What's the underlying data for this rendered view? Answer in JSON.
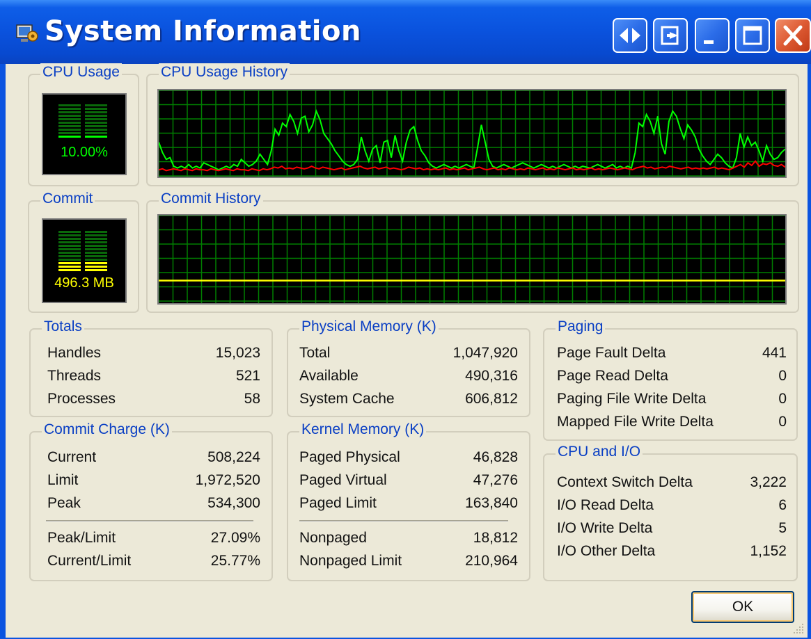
{
  "window": {
    "title": "System Information",
    "icon": "system-info-app-icon",
    "buttons": [
      "restore-arrows-icon",
      "minimize-to-tray-icon",
      "minimize-icon",
      "maximize-icon",
      "close-icon"
    ]
  },
  "cpu": {
    "meter_label": "CPU Usage",
    "meter_value": "10.00%",
    "level": 0.1,
    "history_label": "CPU Usage History",
    "total_series_color": "#00ff00",
    "kernel_series_color": "#ff0000",
    "total_history": [
      40,
      28,
      20,
      22,
      12,
      10,
      12,
      10,
      14,
      10,
      12,
      10,
      16,
      14,
      12,
      10,
      8,
      10,
      12,
      10,
      14,
      12,
      20,
      16,
      12,
      14,
      18,
      26,
      20,
      14,
      30,
      55,
      48,
      62,
      58,
      72,
      64,
      50,
      68,
      70,
      52,
      60,
      76,
      66,
      50,
      44,
      38,
      30,
      24,
      18,
      14,
      12,
      14,
      20,
      46,
      30,
      18,
      32,
      36,
      16,
      40,
      42,
      22,
      48,
      30,
      18,
      40,
      54,
      58,
      42,
      30,
      24,
      16,
      12,
      10,
      12,
      14,
      12,
      10,
      12,
      10,
      12,
      14,
      12,
      10,
      34,
      60,
      40,
      20,
      12,
      10,
      12,
      14,
      12,
      10,
      12,
      14,
      16,
      14,
      12,
      10,
      12,
      14,
      12,
      10,
      12,
      10,
      12,
      14,
      12,
      10,
      12,
      10,
      12,
      11,
      10,
      12,
      14,
      12,
      10,
      12,
      14,
      10,
      12,
      10,
      12,
      10,
      28,
      62,
      58,
      72,
      64,
      50,
      70,
      38,
      26,
      64,
      76,
      70,
      56,
      44,
      60,
      54,
      46,
      32,
      24,
      18,
      14,
      20,
      26,
      22,
      16,
      12,
      10,
      22,
      50,
      34,
      46,
      36,
      40,
      30,
      18,
      36,
      26,
      20,
      22,
      28,
      32
    ],
    "kernel_history": [
      8,
      9,
      7,
      8,
      9,
      8,
      7,
      9,
      8,
      7,
      9,
      8,
      8,
      7,
      9,
      8,
      7,
      8,
      9,
      8,
      7,
      9,
      8,
      8,
      7,
      9,
      8,
      7,
      9,
      8,
      9,
      11,
      10,
      12,
      9,
      10,
      9,
      11,
      10,
      9,
      10,
      12,
      10,
      9,
      11,
      10,
      9,
      8,
      9,
      10,
      8,
      9,
      10,
      11,
      12,
      10,
      9,
      10,
      11,
      9,
      10,
      11,
      9,
      10,
      9,
      8,
      9,
      11,
      10,
      9,
      10,
      8,
      9,
      8,
      9,
      8,
      9,
      10,
      8,
      9,
      8,
      9,
      10,
      8,
      9,
      10,
      11,
      9,
      8,
      9,
      10,
      8,
      9,
      8,
      10,
      9,
      8,
      9,
      8,
      10,
      9,
      8,
      9,
      10,
      8,
      9,
      8,
      10,
      9,
      8,
      9,
      10,
      8,
      9,
      8,
      9,
      10,
      8,
      9,
      8,
      9,
      10,
      9,
      8,
      9,
      10,
      9,
      8,
      10,
      11,
      12,
      10,
      11,
      9,
      10,
      11,
      10,
      12,
      11,
      10,
      9,
      10,
      11,
      9,
      10,
      9,
      10,
      9,
      10,
      11,
      9,
      10,
      9,
      8,
      10,
      12,
      14,
      11,
      16,
      13,
      18,
      12,
      15,
      14,
      16,
      13,
      12,
      14,
      11
    ]
  },
  "commit": {
    "meter_label": "Commit",
    "meter_value": "496.3 MB",
    "level": 0.25,
    "history_label": "Commit History",
    "series_color": "#ffff00",
    "history_level": 25.77
  },
  "totals": {
    "title": "Totals",
    "rows": [
      {
        "label": "Handles",
        "value": "15,023"
      },
      {
        "label": "Threads",
        "value": "521"
      },
      {
        "label": "Processes",
        "value": "58"
      }
    ]
  },
  "physical_memory": {
    "title": "Physical Memory (K)",
    "rows": [
      {
        "label": "Total",
        "value": "1,047,920"
      },
      {
        "label": "Available",
        "value": "490,316"
      },
      {
        "label": "System Cache",
        "value": "606,812"
      }
    ]
  },
  "paging": {
    "title": "Paging",
    "rows": [
      {
        "label": "Page Fault Delta",
        "value": "441"
      },
      {
        "label": "Page Read Delta",
        "value": "0"
      },
      {
        "label": "Paging File Write Delta",
        "value": "0"
      },
      {
        "label": "Mapped File Write Delta",
        "value": "0"
      }
    ]
  },
  "commit_charge": {
    "title": "Commit Charge (K)",
    "rows": [
      {
        "label": "Current",
        "value": "508,224"
      },
      {
        "label": "Limit",
        "value": "1,972,520"
      },
      {
        "label": "Peak",
        "value": "534,300"
      },
      {
        "label": "Peak/Limit",
        "value": "27.09%"
      },
      {
        "label": "Current/Limit",
        "value": "25.77%"
      }
    ]
  },
  "kernel_memory": {
    "title": "Kernel Memory (K)",
    "rows": [
      {
        "label": "Paged Physical",
        "value": "46,828"
      },
      {
        "label": "Paged Virtual",
        "value": "47,276"
      },
      {
        "label": "Paged Limit",
        "value": "163,840"
      },
      {
        "label": "Nonpaged",
        "value": "18,812"
      },
      {
        "label": "Nonpaged Limit",
        "value": "210,964"
      }
    ]
  },
  "cpu_io": {
    "title": "CPU and I/O",
    "rows": [
      {
        "label": "Context Switch Delta",
        "value": "3,222"
      },
      {
        "label": "I/O Read Delta",
        "value": "6"
      },
      {
        "label": "I/O Write Delta",
        "value": "5"
      },
      {
        "label": "I/O Other Delta",
        "value": "1,152"
      }
    ]
  },
  "ok_button": {
    "label": "OK"
  }
}
